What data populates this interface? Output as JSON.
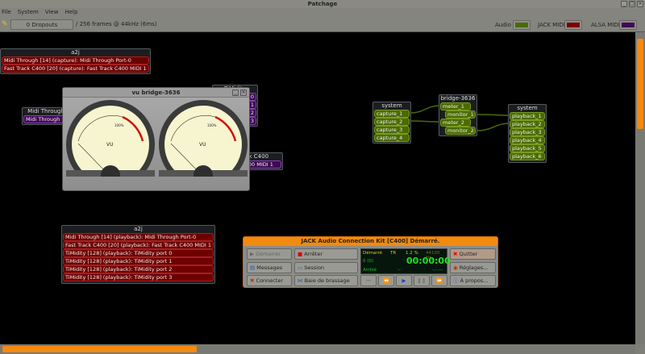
{
  "window": {
    "title": "Patchage",
    "min": "_",
    "max": "□",
    "close": "×"
  },
  "menu": [
    "File",
    "System",
    "View",
    "Help"
  ],
  "toolbar": {
    "dropouts": "0 Dropouts",
    "buffer": "/ 256 frames @ 44kHz (6ms)",
    "legend": [
      {
        "label": "Audio",
        "color": "#4a6b00"
      },
      {
        "label": "JACK MIDI",
        "color": "#7a0000"
      },
      {
        "label": "ALSA MIDI",
        "color": "#3f0a55"
      }
    ]
  },
  "modules": {
    "a2j_capture": {
      "title": "a2j",
      "ports": [
        "Midi Through [14] (capture): Midi Through Port-0",
        "Fast Track C400 [20] (capture): Fast Track C400 MIDI 1"
      ]
    },
    "midi_through": {
      "title": "Midi Through",
      "ports": [
        "Midi Through"
      ]
    },
    "timidity": {
      "title": "TiMidity",
      "ports": [
        "0",
        "1",
        "2",
        "3"
      ]
    },
    "fast_track": {
      "title": "Fast Track C400",
      "ports": [
        "Fast Track C400 MIDI 1"
      ]
    },
    "system_capture": {
      "title": "system",
      "ports": [
        "capture_1",
        "capture_2",
        "capture_3",
        "capture_4"
      ]
    },
    "bridge": {
      "title": "bridge-3636",
      "ports": [
        "meter_1",
        "monitor_1",
        "meter_2",
        "monitor_2"
      ]
    },
    "system_playback": {
      "title": "system",
      "ports": [
        "playback_1",
        "playback_2",
        "playback_3",
        "playback_4",
        "playback_5",
        "playback_6"
      ]
    },
    "a2j_playback": {
      "title": "a2j",
      "ports": [
        "Midi Through [14] (playback): Midi Through Port-0",
        "Fast Track C400 [20] (playback): Fast Track C400 MIDI 1",
        "TiMidity [128] (playback): TiMidity port 0",
        "TiMidity [128] (playback): TiMidity port 1",
        "TiMidity [128] (playback): TiMidity port 2",
        "TiMidity [128] (playback): TiMidity port 3"
      ]
    }
  },
  "vu": {
    "title": "vu bridge-3636",
    "label": "VU",
    "pct": "100%"
  },
  "jack": {
    "title": "JACK Audio Connection Kit [C400] Démarré.",
    "buttons": {
      "start": "Démarrer",
      "stop": "Arrêter",
      "quit": "Quitter",
      "messages": "Messages",
      "session": "Session",
      "settings": "Réglages...",
      "connect": "Connecter",
      "patchbay": "Baie de brassage",
      "about": "À propos..."
    },
    "display": {
      "state": "Démarré",
      "tr": "TR",
      "load": "1.2 %",
      "rate": "44100 Hz",
      "xruns": "0 (0)",
      "time": "00:00:00",
      "transport": "Arrêté",
      "dash": "--",
      "bbt": "-.-.---"
    }
  }
}
